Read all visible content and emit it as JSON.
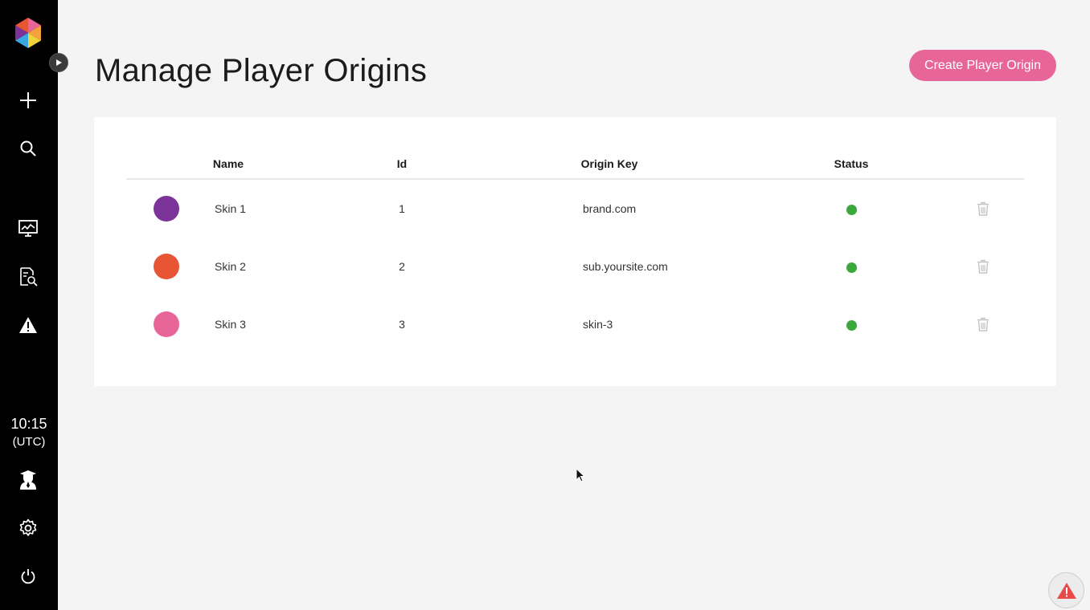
{
  "page": {
    "title": "Manage Player Origins",
    "create_button_label": "Create Player Origin"
  },
  "sidebar": {
    "icons": [
      "logo-icon",
      "plus-icon",
      "search-icon",
      "monitor-chart-icon",
      "report-search-icon",
      "warning-icon",
      "graduate-icon",
      "gear-icon",
      "power-icon"
    ],
    "clock": {
      "time": "10:15",
      "timezone": "(UTC)"
    }
  },
  "table": {
    "columns": [
      "Name",
      "Id",
      "Origin Key",
      "Status"
    ],
    "rows": [
      {
        "name": "Skin 1",
        "id": "1",
        "origin_key": "brand.com",
        "color": "#7b3399",
        "status": "active"
      },
      {
        "name": "Skin 2",
        "id": "2",
        "origin_key": "sub.yoursite.com",
        "color": "#e85535",
        "status": "active"
      },
      {
        "name": "Skin 3",
        "id": "3",
        "origin_key": "skin-3",
        "color": "#e8659a",
        "status": "active"
      }
    ]
  },
  "colors": {
    "accent": "#e8659a",
    "status_active": "#3aa83a",
    "sidebar_bg": "#000000",
    "page_bg": "#f4f4f4"
  }
}
